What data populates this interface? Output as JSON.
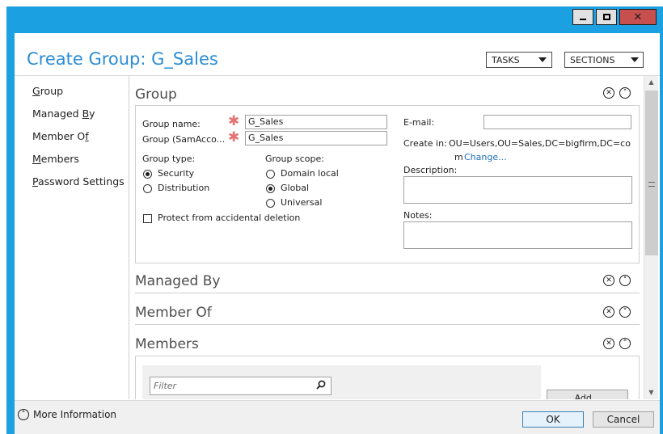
{
  "window": {
    "title": "Create Group: G_Sales",
    "tasks_label": "TASKS",
    "sections_label": "SECTIONS"
  },
  "nav": {
    "items": [
      {
        "label": "Group",
        "underline": "G",
        "rest": "roup"
      },
      {
        "label": "Managed By",
        "pre": "Managed ",
        "underline": "B",
        "rest": "y"
      },
      {
        "label": "Member Of",
        "pre": "Member O",
        "underline": "f",
        "rest": ""
      },
      {
        "label": "Members",
        "underline": "M",
        "rest": "embers"
      },
      {
        "label": "Password Settings",
        "underline": "P",
        "rest": "assword Settings"
      }
    ]
  },
  "group_section": {
    "title": "Group",
    "group_name_label": "Group name:",
    "group_name_value": "G_Sales",
    "sam_label": "Group (SamAcco...",
    "sam_value": "G_Sales",
    "group_type_label": "Group type:",
    "type_security": "Security",
    "type_distribution": "Distribution",
    "group_scope_label": "Group scope:",
    "scope_domain_local": "Domain local",
    "scope_global": "Global",
    "scope_universal": "Universal",
    "protect_label": "Protect from accidental deletion",
    "email_label": "E-mail:",
    "email_value": "",
    "create_in_label": "Create in:",
    "create_in_value_line1": "OU=Users,OU=Sales,DC=bigfirm,DC=co",
    "create_in_value_line2": "m",
    "change_link": "Change...",
    "description_label": "Description:",
    "description_value": "",
    "notes_label": "Notes:",
    "notes_value": ""
  },
  "sections": {
    "managed_by": "Managed By",
    "member_of": "Member Of",
    "members": "Members"
  },
  "members": {
    "filter_placeholder": "Filter",
    "add_label": "Add..."
  },
  "footer": {
    "more_info": "More Information",
    "ok": "OK",
    "cancel": "Cancel"
  },
  "colors": {
    "title_blue": "#2a8dd4",
    "frame_blue": "#1ba1e2",
    "required_star": "#e57373",
    "link": "#1e6fb8"
  }
}
